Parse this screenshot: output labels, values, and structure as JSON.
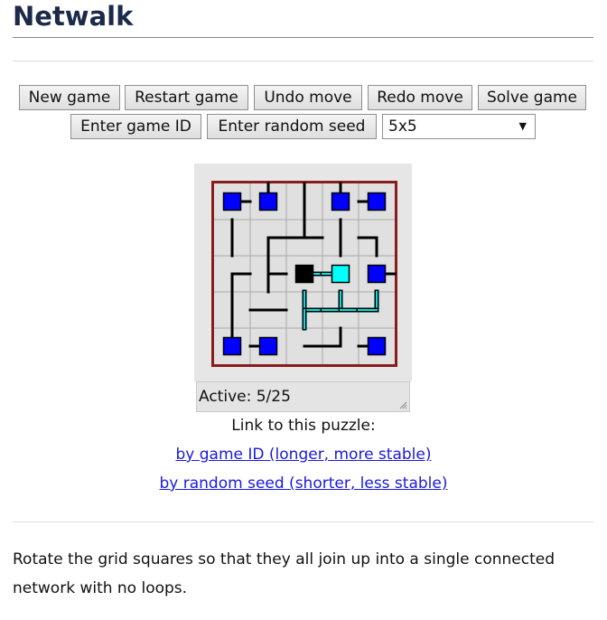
{
  "page": {
    "title": "Netwalk"
  },
  "toolbar": {
    "new_game": "New game",
    "restart_game": "Restart game",
    "undo_move": "Undo move",
    "redo_move": "Redo move",
    "solve_game": "Solve game",
    "enter_game_id": "Enter game ID",
    "enter_random_seed": "Enter random seed",
    "size_select_value": "5x5"
  },
  "game": {
    "grid_size": 5,
    "status": "Active: 5/25",
    "colors": {
      "tile_background": "#e0e0e0",
      "grid_line": "#a8a8a8",
      "border": "#8a1c1c",
      "wire_unpowered": "#000000",
      "wire_powered": "#00e0e0",
      "endpoint_unpowered": "#0000ff",
      "endpoint_powered": "#00ffff",
      "source": "#000000"
    },
    "tiles": [
      {
        "row": 0,
        "col": 0,
        "dirs": "R",
        "kind": "endpoint",
        "powered": false
      },
      {
        "row": 0,
        "col": 1,
        "dirs": "U",
        "kind": "endpoint",
        "powered": false
      },
      {
        "row": 0,
        "col": 2,
        "dirs": "UD",
        "kind": "wire",
        "powered": false
      },
      {
        "row": 0,
        "col": 3,
        "dirs": "U",
        "kind": "endpoint",
        "powered": false
      },
      {
        "row": 0,
        "col": 4,
        "dirs": "L",
        "kind": "endpoint",
        "powered": false
      },
      {
        "row": 1,
        "col": 0,
        "dirs": "UD",
        "kind": "wire",
        "powered": false
      },
      {
        "row": 1,
        "col": 1,
        "dirs": "RD",
        "kind": "wire",
        "powered": false
      },
      {
        "row": 1,
        "col": 2,
        "dirs": "ULR",
        "kind": "wire",
        "powered": false
      },
      {
        "row": 1,
        "col": 3,
        "dirs": "UD",
        "kind": "wire",
        "powered": false
      },
      {
        "row": 1,
        "col": 4,
        "dirs": "LD",
        "kind": "wire",
        "powered": false
      },
      {
        "row": 2,
        "col": 0,
        "dirs": "RD",
        "kind": "wire",
        "powered": false
      },
      {
        "row": 2,
        "col": 1,
        "dirs": "UDR",
        "kind": "wire",
        "powered": false
      },
      {
        "row": 2,
        "col": 2,
        "dirs": "R",
        "kind": "source",
        "powered": true
      },
      {
        "row": 2,
        "col": 3,
        "dirs": "L",
        "kind": "endpoint",
        "powered": true
      },
      {
        "row": 2,
        "col": 4,
        "dirs": "R",
        "kind": "endpoint",
        "powered": false
      },
      {
        "row": 3,
        "col": 0,
        "dirs": "UD",
        "kind": "wire",
        "powered": false
      },
      {
        "row": 3,
        "col": 1,
        "dirs": "LR",
        "kind": "wire",
        "powered": false
      },
      {
        "row": 3,
        "col": 2,
        "dirs": "URD",
        "kind": "wire",
        "powered": true
      },
      {
        "row": 3,
        "col": 3,
        "dirs": "ULR",
        "kind": "wire",
        "powered": true
      },
      {
        "row": 3,
        "col": 4,
        "dirs": "UL",
        "kind": "wire",
        "powered": true
      },
      {
        "row": 4,
        "col": 0,
        "dirs": "U",
        "kind": "endpoint",
        "powered": false
      },
      {
        "row": 4,
        "col": 1,
        "dirs": "L",
        "kind": "endpoint",
        "powered": false
      },
      {
        "row": 4,
        "col": 2,
        "dirs": "R",
        "kind": "wire",
        "powered": false
      },
      {
        "row": 4,
        "col": 3,
        "dirs": "UL",
        "kind": "wire",
        "powered": false
      },
      {
        "row": 4,
        "col": 4,
        "dirs": "L",
        "kind": "endpoint",
        "powered": false
      }
    ]
  },
  "links": {
    "heading": "Link to this puzzle:",
    "by_game_id": "by game ID (longer, more stable)",
    "by_random_seed": "by random seed (shorter, less stable)"
  },
  "description": "Rotate the grid squares so that they all join up into a single connected network with no loops."
}
